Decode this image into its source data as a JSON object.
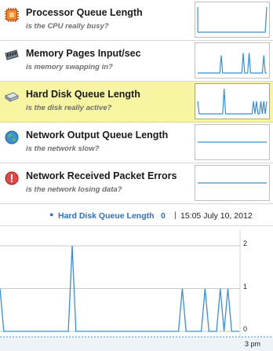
{
  "counters": [
    {
      "name": "Processor Queue Length",
      "description": "is the CPU really busy?",
      "icon": "cpu-chip-icon",
      "selected": false,
      "spark": [
        0,
        0,
        0,
        0,
        0,
        0,
        0,
        0,
        0,
        0,
        0,
        0,
        0,
        0,
        0,
        0,
        0,
        0,
        0,
        0,
        0,
        0,
        0,
        0,
        0,
        0,
        0,
        0,
        0,
        0,
        0,
        0,
        0,
        0,
        0,
        0,
        0,
        0,
        0,
        0,
        0,
        0,
        0,
        0,
        0,
        0,
        0,
        1
      ]
    },
    {
      "name": "Memory Pages Input/sec",
      "description": "is memory swapping in?",
      "icon": "memory-module-icon",
      "selected": false,
      "spark": [
        0,
        0,
        0,
        0,
        0,
        0,
        0,
        0,
        0,
        0,
        0,
        0,
        0,
        0,
        0,
        0,
        0.7,
        0,
        0,
        0,
        0,
        0,
        0,
        0,
        0,
        0,
        0,
        0,
        0,
        0,
        0,
        0.8,
        0,
        0,
        0,
        0.8,
        0,
        0,
        0,
        0,
        0,
        0,
        0,
        0,
        0,
        0.7,
        0,
        0
      ]
    },
    {
      "name": "Hard Disk Queue Length",
      "description": "is the disk really active?",
      "icon": "hard-disk-icon",
      "selected": true,
      "spark": [
        0.5,
        0,
        0,
        0,
        0,
        0,
        0,
        0,
        0,
        0,
        0,
        0,
        0,
        0,
        0,
        0,
        0,
        0,
        1,
        0,
        0,
        0,
        0,
        0,
        0,
        0,
        0,
        0,
        0,
        0,
        0,
        0,
        0,
        0,
        0,
        0,
        0,
        0,
        0.5,
        0,
        0.5,
        0,
        0,
        0.5,
        0,
        0.5,
        0,
        0.5
      ]
    },
    {
      "name": "Network Output Queue Length",
      "description": "is the network slow?",
      "icon": "globe-icon",
      "selected": false,
      "spark": [
        0.5,
        0.5
      ]
    },
    {
      "name": "Network Received Packet Errors",
      "description": "is the network losing data?",
      "icon": "error-alert-icon",
      "selected": false,
      "spark": [
        0.5,
        0.5
      ]
    }
  ],
  "status_bar": {
    "series_label": "Hard Disk Queue Length",
    "current_value": "0",
    "separator": "|",
    "timestamp": "15:05 July 10, 2012"
  },
  "chart_data": {
    "type": "line",
    "title": "",
    "series": [
      {
        "name": "Hard Disk Queue Length",
        "values": [
          1,
          0,
          0,
          0,
          0,
          0,
          0,
          0,
          0,
          0,
          0,
          0,
          0,
          0,
          0,
          0,
          0,
          0,
          0,
          2,
          0,
          0,
          0,
          0,
          0,
          0,
          0,
          0,
          0,
          0,
          0,
          0,
          0,
          0,
          0,
          0,
          0,
          0,
          0,
          0,
          0,
          0,
          0,
          0,
          0,
          0,
          0,
          0,
          1,
          0,
          0,
          0,
          0,
          0,
          1,
          0,
          0,
          0,
          1,
          0,
          1,
          0,
          0,
          0
        ]
      }
    ],
    "ylim": [
      0,
      2
    ],
    "yticks": [
      "2",
      "1",
      "0"
    ],
    "xticks": [
      "3 pm"
    ],
    "grid": true,
    "colors": {
      "line": "#3a8fd1",
      "grid": "#c9c9c9"
    }
  },
  "colors": {
    "selected_row": "#f8f5a2",
    "accent_blue": "#2f6fbf",
    "spark_line": "#3a8fd1"
  }
}
